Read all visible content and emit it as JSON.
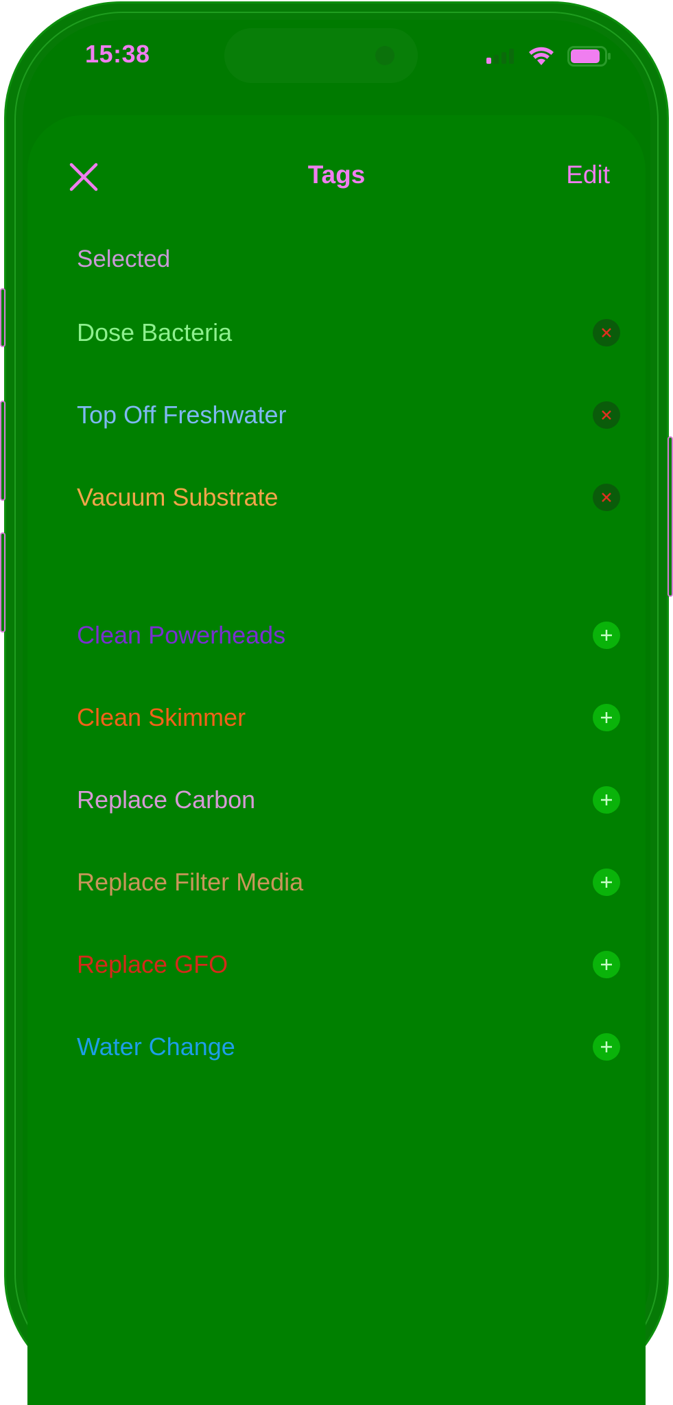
{
  "status_bar": {
    "time": "15:38",
    "time_color": "#f07ef0"
  },
  "nav": {
    "title": "Tags",
    "edit_label": "Edit",
    "accent_color": "#f07ef0"
  },
  "selected_section": {
    "header": "Selected",
    "items": [
      {
        "label": "Dose Bacteria",
        "color": "#8ef08e",
        "action_icon": "remove-x-icon"
      },
      {
        "label": "Top Off Freshwater",
        "color": "#7fb8f2",
        "action_icon": "remove-x-icon"
      },
      {
        "label": "Vacuum Substrate",
        "color": "#f2a54a",
        "action_icon": "remove-x-icon"
      }
    ]
  },
  "available_section": {
    "items": [
      {
        "label": "Clean Powerheads",
        "color": "#7a2fd0",
        "action_icon": "add-plus-icon"
      },
      {
        "label": "Clean Skimmer",
        "color": "#f2621a",
        "action_icon": "add-plus-icon"
      },
      {
        "label": "Replace Carbon",
        "color": "#d69ad6",
        "action_icon": "add-plus-icon"
      },
      {
        "label": "Replace Filter Media",
        "color": "#c8965a",
        "action_icon": "add-plus-icon"
      },
      {
        "label": "Replace GFO",
        "color": "#d42a1a",
        "action_icon": "add-plus-icon"
      },
      {
        "label": "Water Change",
        "color": "#1e9ee8",
        "action_icon": "add-plus-icon"
      }
    ]
  },
  "colors": {
    "background": "#008000",
    "remove_glyph": "#e03020",
    "add_glyph": "#c8ffc8"
  }
}
